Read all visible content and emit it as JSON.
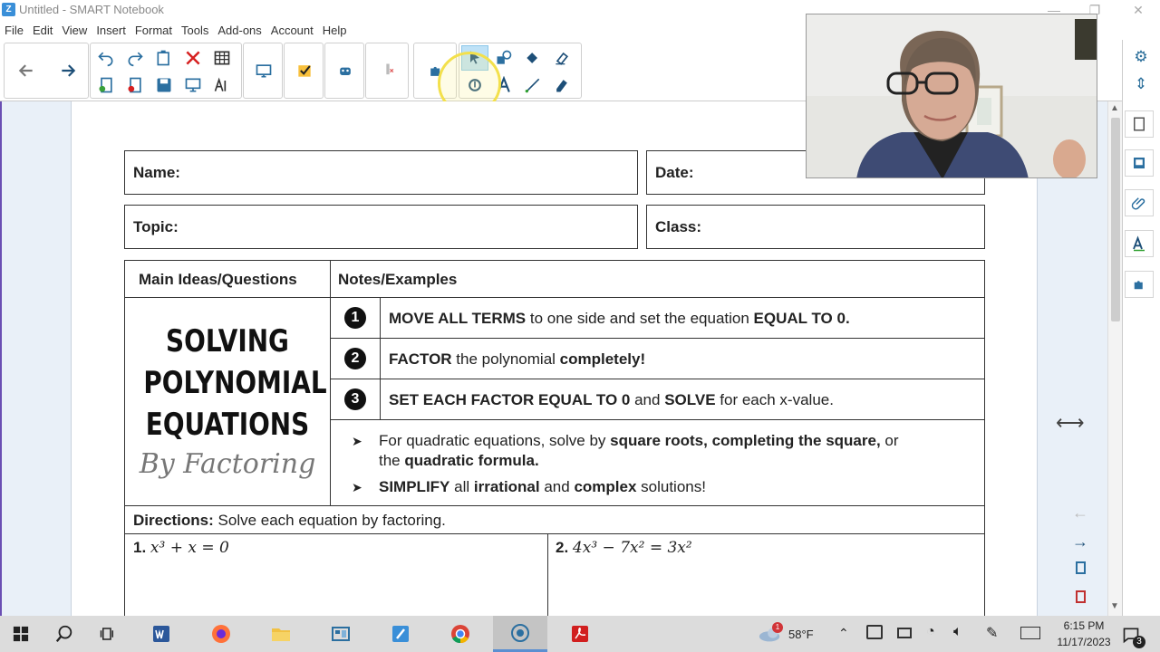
{
  "window": {
    "title": "Untitled - SMART Notebook",
    "app_icon": "notebook-icon"
  },
  "menu": [
    "File",
    "Edit",
    "View",
    "Insert",
    "Format",
    "Tools",
    "Add-ons",
    "Account",
    "Help"
  ],
  "toolbar": {
    "icons": [
      "back-arrow-icon",
      "forward-arrow-icon",
      "undo-icon",
      "redo-icon",
      "paste-icon",
      "delete-icon",
      "table-icon",
      "add-page-icon",
      "delete-page-icon",
      "save-icon",
      "screenshade-icon",
      "text-to-speech-icon",
      "screen-capture-icon",
      "response-check-icon",
      "gadget-icon",
      "pen-tool-icon",
      "puzzle-icon",
      "select-icon",
      "shapes-icon",
      "fill-icon",
      "eraser-icon",
      "magic-pen-icon",
      "text-icon",
      "line-icon",
      "smart-ink-icon"
    ],
    "selected": "select-icon",
    "accent_color": "#2b6fa0"
  },
  "worksheet": {
    "name_label": "Name:",
    "date_label": "Date:",
    "topic_label": "Topic:",
    "class_label": "Class:",
    "col1_header": "Main Ideas/Questions",
    "col2_header": "Notes/Examples",
    "title_line1": "SOLVING",
    "title_line2": "POLYNOMIAL",
    "title_line3": "EQUATIONS",
    "subtitle": "By Factoring",
    "steps": [
      {
        "num": "1",
        "bold1": "MOVE ALL TERMS",
        "text1": " to one side and set the equation ",
        "bold2": "EQUAL TO 0.",
        "text2": ""
      },
      {
        "num": "2",
        "bold1": "FACTOR",
        "text1": " the polynomial ",
        "bold2": "completely!",
        "text2": ""
      },
      {
        "num": "3",
        "bold1": "SET EACH FACTOR EQUAL TO 0",
        "text1": " and ",
        "bold2": "SOLVE",
        "text2": " for each x-value."
      }
    ],
    "bullet1_a": "For quadratic equations, solve by ",
    "bullet1_b": "square roots, completing the square,",
    "bullet1_c": " or",
    "bullet1_d": "the ",
    "bullet1_e": "quadratic formula.",
    "bullet2_a": "SIMPLIFY",
    "bullet2_b": " all ",
    "bullet2_c": "irrational",
    "bullet2_d": " and ",
    "bullet2_e": "complex",
    "bullet2_f": " solutions!",
    "directions_label": "Directions:",
    "directions_text": " Solve each equation by factoring.",
    "problem1_num": "1.",
    "problem1": "x³ + x = 0",
    "problem2_num": "2.",
    "problem2": "4x³ − 7x² = 3x²"
  },
  "sidebar": {
    "icons": [
      "settings-icon",
      "move-toolbar-icon",
      "page-sorter-icon",
      "gallery-icon",
      "attachments-icon",
      "properties-icon",
      "addons-icon"
    ]
  },
  "right_controls": {
    "icons": [
      "swap-sides-icon",
      "previous-page-icon",
      "next-page-icon",
      "add-page-small-icon",
      "delete-page-small-icon"
    ]
  },
  "taskbar": {
    "icons": [
      "windows-start-icon",
      "search-icon",
      "task-view-icon",
      "word-icon",
      "firefox-icon",
      "file-explorer-icon",
      "network-app-icon",
      "smart-notebook-icon",
      "chrome-icon",
      "screen-recorder-icon",
      "acrobat-icon"
    ],
    "weather": "58°F",
    "time": "6:15 PM",
    "date": "11/17/2023",
    "notification_count": "3",
    "weather_alert": "1"
  }
}
